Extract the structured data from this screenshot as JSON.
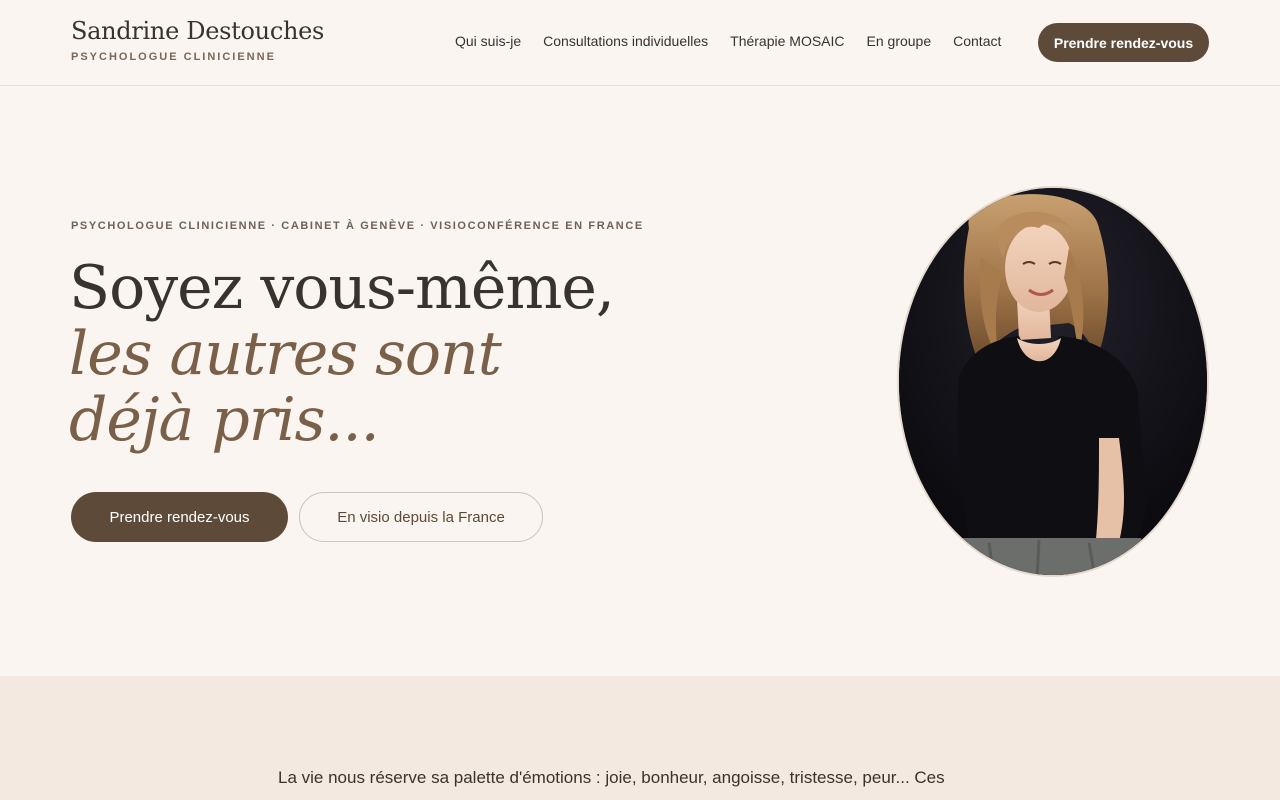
{
  "header": {
    "brand_name": "Sandrine Destouches",
    "brand_subtitle": "PSYCHOLOGUE CLINICIENNE",
    "nav": [
      {
        "label": "Qui suis-je"
      },
      {
        "label": "Consultations individuelles"
      },
      {
        "label": "Thérapie MOSAIC"
      },
      {
        "label": "En groupe"
      },
      {
        "label": "Contact"
      }
    ],
    "cta_label": "Prendre rendez-vous"
  },
  "hero": {
    "eyebrow": "PSYCHOLOGUE CLINICIENNE · CABINET À GENÈVE · VISIOCONFÉRENCE EN FRANCE",
    "headline_line1": "Soyez vous-même,",
    "headline_line2": "les autres sont déjà pris...",
    "primary_button": "Prendre rendez-vous",
    "secondary_button": "En visio depuis la France"
  },
  "intro": {
    "text": "La vie nous réserve sa palette d'émotions : joie, bonheur, angoisse, tristesse, peur... Ces"
  },
  "colors": {
    "background": "#faf5f0",
    "accent_brown": "#5d4a38",
    "headline_italic": "#7a6048",
    "intro_band": "#f3e9e1"
  }
}
